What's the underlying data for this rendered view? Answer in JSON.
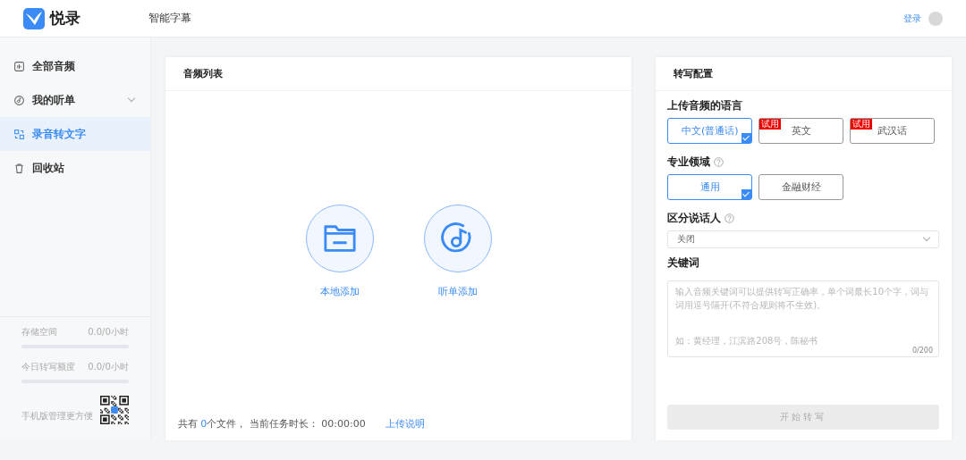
{
  "header": {
    "brand": "悦录",
    "nav_title": "智能字幕",
    "login": "登录"
  },
  "sidebar": {
    "items": [
      {
        "label": "全部音频",
        "selected": false,
        "expandable": false
      },
      {
        "label": "我的听单",
        "selected": false,
        "expandable": true
      },
      {
        "label": "录音转文字",
        "selected": true,
        "expandable": false
      },
      {
        "label": "回收站",
        "selected": false,
        "expandable": false
      }
    ],
    "quotas": [
      {
        "label": "存储空间",
        "reading": "0.0/0小时",
        "level": 0
      },
      {
        "label": "今日转写额度",
        "reading": "0.0/0小时",
        "level": 0
      }
    ],
    "mobile_hint": "手机版管理更方便"
  },
  "audio_list": {
    "title": "音频列表",
    "actions": [
      {
        "label": "本地添加"
      },
      {
        "label": "听单添加"
      }
    ],
    "footer": {
      "count_prefix": "共有",
      "count": "0",
      "count_suffix": "个文件，",
      "duration_label": "当前任务时长：",
      "duration": "00:00:00",
      "help_link": "上传说明"
    }
  },
  "config": {
    "title": "转写配置",
    "language": {
      "label": "上传音频的语言",
      "options": [
        {
          "label": "中文(普通话)",
          "selected": true
        },
        {
          "label": "英文",
          "selected": false,
          "badge": "试用"
        },
        {
          "label": "武汉话",
          "selected": false,
          "badge": "试用"
        }
      ]
    },
    "domain": {
      "label": "专业领域",
      "options": [
        {
          "label": "通用",
          "selected": true
        },
        {
          "label": "金融财经",
          "selected": false
        }
      ]
    },
    "speaker": {
      "label": "区分说话人",
      "value": "关闭"
    },
    "keywords": {
      "label": "关键词",
      "placeholder": "输入音频关键词可以提供转写正确率，单个词最长10个字，词与词用逗号隔开(不符合规则将不生效)。",
      "example": "如：黄经理，江滨路208号，陈秘书",
      "counter": "0/200"
    },
    "start_button": {
      "label": "开始转写",
      "disabled": true
    }
  }
}
